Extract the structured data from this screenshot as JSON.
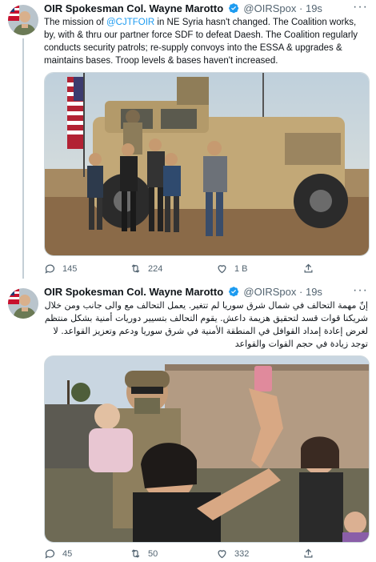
{
  "tweets": [
    {
      "author_name": "OIR Spokesman Col. Wayne Marotto",
      "handle": "@OIRSpox",
      "separator": "·",
      "time": "19s",
      "text_before_mention": "The mission of ",
      "mention": "@CJTFOIR",
      "text_after_mention": " in NE Syria hasn't changed. The Coalition works, by, with & thru our partner force SDF to defeat Daesh. The Coalition regularly conducts security patrols; re-supply convoys into the ESSA & upgrades & maintains bases. Troop levels & bases haven't increased.",
      "media_description": "Soldier standing on an armored vehicle with children in front, American flag",
      "reply_count": "145",
      "retweet_count": "224",
      "like_count": "1 B"
    },
    {
      "author_name": "OIR Spokesman Col. Wayne Marotto",
      "handle": "@OIRSpox",
      "separator": "·",
      "time": "19s",
      "text": "إنّ مهمة التحالف في شمال شرق سوريا لم تتغير. يعمل التحالف مع والى جانب ومن خلال شريكنا قوات قسد لتحقيق هزيمة داعش. يقوم التحالف بتسيير دوريات أمنية بشكل منتظم لغرض إعادة إمداد القوافل في المنطقة الأمنية في شرق سوريا ودعم وتعزيز القواعد. لا توجد زيادة في حجم القوات والقواعد",
      "media_description": "Woman taking a selfie with children and a soldier holding a child",
      "reply_count": "45",
      "retweet_count": "50",
      "like_count": "332"
    }
  ],
  "more_label": "···"
}
